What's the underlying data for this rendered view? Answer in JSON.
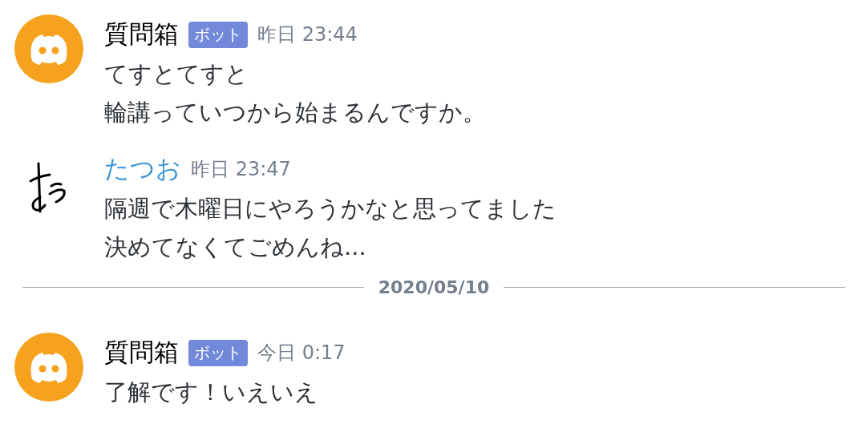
{
  "feed": [
    {
      "kind": "message",
      "avatar": {
        "kind": "bot-logo"
      },
      "author": {
        "name": "質問箱",
        "color": "#000000"
      },
      "tag": "ボット",
      "timestamp": "昨日 23:44",
      "lines": [
        "てすとてすと",
        "輪講っていつから始まるんですか。"
      ]
    },
    {
      "kind": "message",
      "avatar": {
        "kind": "signature"
      },
      "author": {
        "name": "たつお",
        "color": "#3b95d4"
      },
      "timestamp": "昨日 23:47",
      "lines": [
        "隔週で木曜日にやろうかなと思ってました",
        "決めてなくてごめんね..."
      ]
    },
    {
      "kind": "divider",
      "label": "2020/05/10"
    },
    {
      "kind": "message",
      "avatar": {
        "kind": "bot-logo"
      },
      "author": {
        "name": "質問箱",
        "color": "#000000"
      },
      "tag": "ボット",
      "timestamp": "今日 0:17",
      "lines": [
        "了解です！いえいえ"
      ]
    }
  ]
}
